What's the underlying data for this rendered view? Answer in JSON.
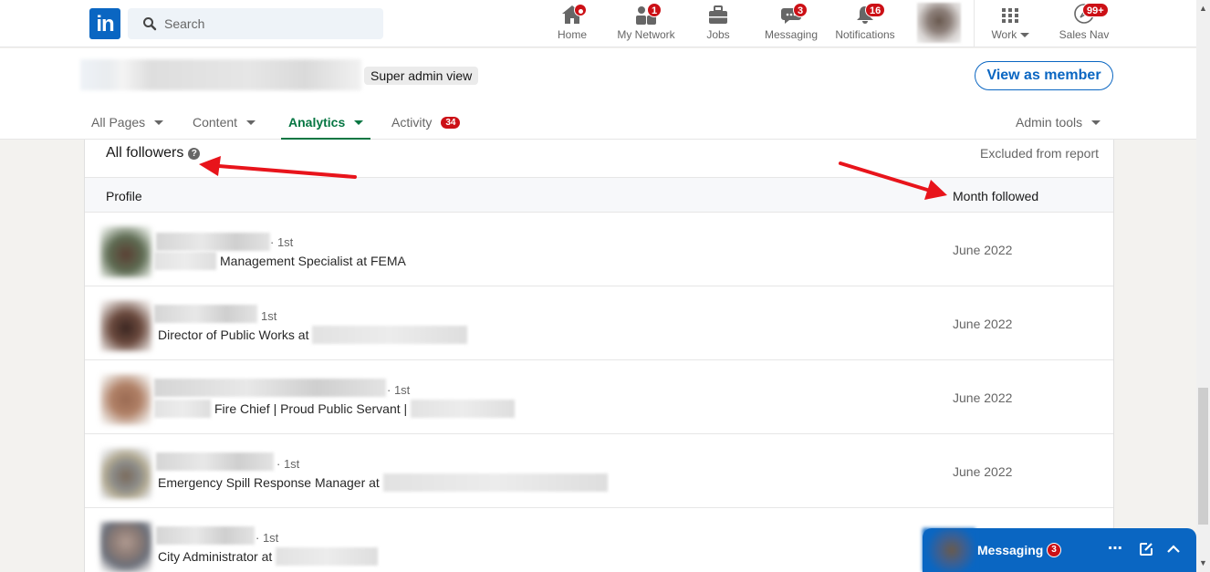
{
  "nav": {
    "logo": "in",
    "search_placeholder": "Search",
    "items": [
      {
        "label": "Home",
        "icon": "home-icon",
        "badge": ""
      },
      {
        "label": "My Network",
        "icon": "network-icon",
        "badge": "1"
      },
      {
        "label": "Jobs",
        "icon": "briefcase-icon",
        "badge": ""
      },
      {
        "label": "Messaging",
        "icon": "chat-icon",
        "badge": "3"
      },
      {
        "label": "Notifications",
        "icon": "bell-icon",
        "badge": "16"
      },
      {
        "label": "Work",
        "icon": "grid-icon",
        "badge": ""
      },
      {
        "label": "Sales Nav",
        "icon": "compass-icon",
        "badge": "99+"
      }
    ]
  },
  "page_header": {
    "super_admin_label": "Super admin view",
    "view_as_member_label": "View as member",
    "tabs": [
      {
        "label": "All Pages",
        "active": false
      },
      {
        "label": "Content",
        "active": false
      },
      {
        "label": "Analytics",
        "active": true
      },
      {
        "label": "Activity",
        "badge": "34"
      }
    ],
    "admin_tools_label": "Admin tools"
  },
  "followers": {
    "title": "All followers",
    "excluded_label": "Excluded from report",
    "columns": {
      "profile": "Profile",
      "month": "Month followed"
    },
    "rows": [
      {
        "degree": "· 1st",
        "headline": "Management Specialist at FEMA",
        "month": "June 2022"
      },
      {
        "degree": "1st",
        "headline": "Director of Public Works at",
        "month": "June 2022"
      },
      {
        "degree": "· 1st",
        "headline": "Fire Chief | Proud Public Servant |",
        "month": "June 2022"
      },
      {
        "degree": "· 1st",
        "headline": "Emergency Spill Response Manager at",
        "month": "June 2022"
      },
      {
        "degree": "· 1st",
        "headline": "City Administrator at",
        "month": ""
      }
    ]
  },
  "messaging_overlay": {
    "label": "Messaging",
    "badge": "3"
  },
  "colors": {
    "brand": "#0a66c2",
    "active_tab": "#057642",
    "badge": "#cc1016",
    "annotation_arrow": "#e8141b"
  }
}
